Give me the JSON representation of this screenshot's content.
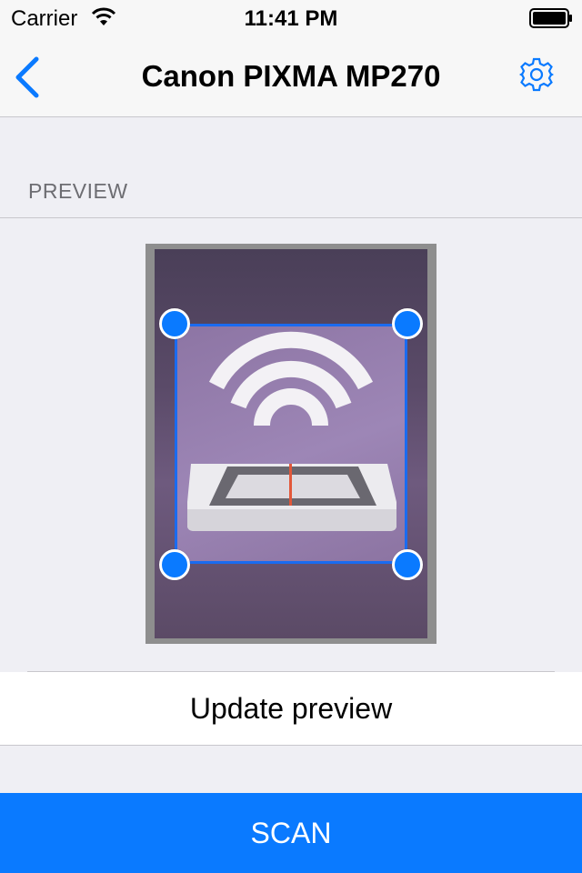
{
  "status_bar": {
    "carrier": "Carrier",
    "time": "11:41 PM"
  },
  "navbar": {
    "title": "Canon PIXMA MP270",
    "back_icon": "chevron-left-icon",
    "settings_icon": "gear-icon"
  },
  "preview": {
    "section_header": "PREVIEW",
    "update_label": "Update preview"
  },
  "actions": {
    "scan_label": "SCAN"
  },
  "colors": {
    "accent": "#0a7aff",
    "background": "#efeff4"
  }
}
